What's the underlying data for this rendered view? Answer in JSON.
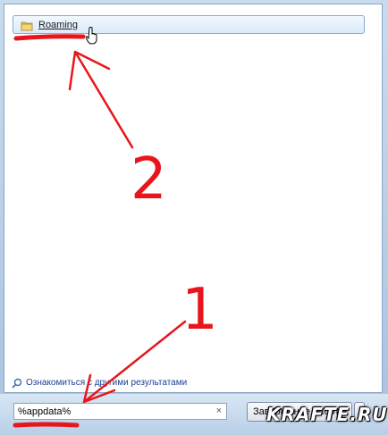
{
  "results": {
    "item_label": "Roaming",
    "item_icon": "folder-icon"
  },
  "more_results": {
    "label": "Ознакомиться с другими результатами",
    "icon": "search-magnifier-icon"
  },
  "search": {
    "value": "%appdata%",
    "clear_icon": "×"
  },
  "shutdown": {
    "label": "Завершение работы"
  },
  "annotations": {
    "number_one": "1",
    "number_two": "2",
    "color": "#e8161c"
  },
  "watermark": {
    "text": "KRAFTE.RU"
  }
}
